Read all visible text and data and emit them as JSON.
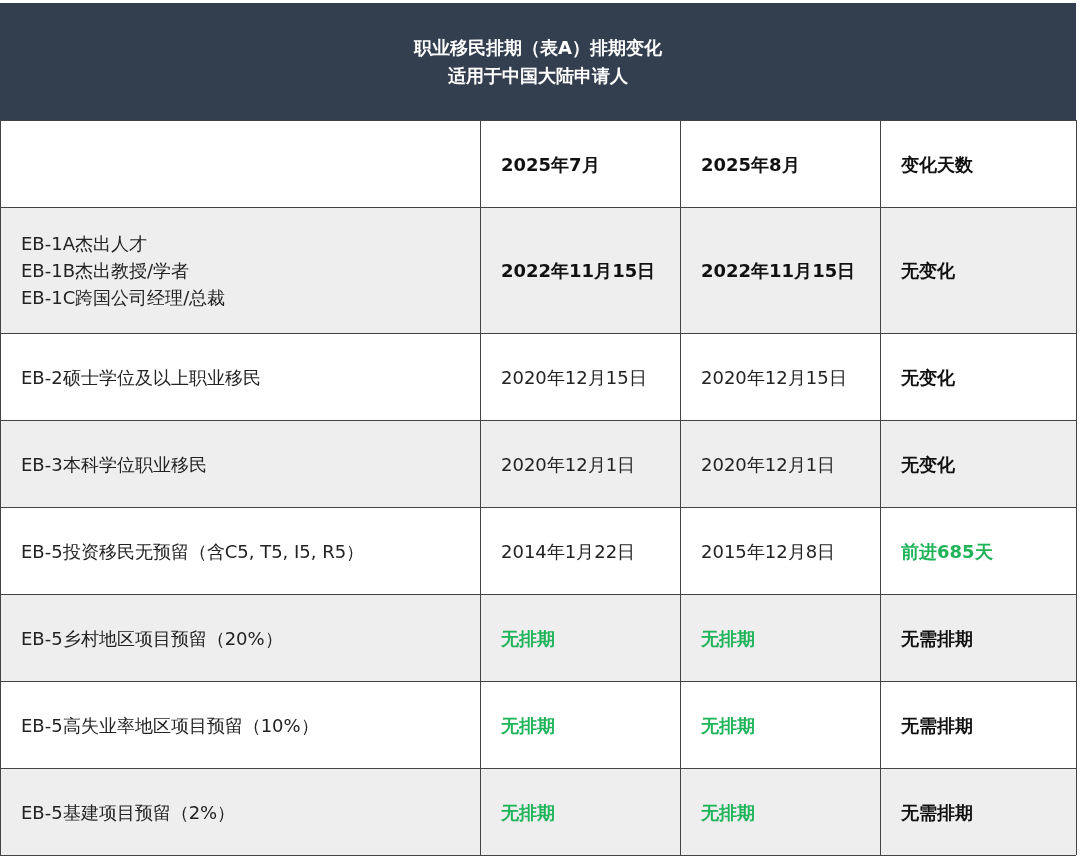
{
  "title": {
    "lines": [
      "职业移民排期（表A）排期变化",
      "适用于中国大陆申请人"
    ]
  },
  "table": {
    "columns": [
      "",
      "2025年7月",
      "2025年8月",
      "变化天数"
    ],
    "rows": [
      {
        "cells": [
          {
            "text": "EB-1A杰出人才\nEB-1B杰出教授/学者\nEB-1C跨国公司经理/总裁",
            "bold": false,
            "color": "#222222"
          },
          {
            "text": "2022年11月15日",
            "bold": true,
            "color": "#111111"
          },
          {
            "text": "2022年11月15日",
            "bold": true,
            "color": "#111111"
          },
          {
            "text": "无变化",
            "bold": true,
            "color": "#111111"
          }
        ]
      },
      {
        "cells": [
          {
            "text": "EB-2硕士学位及以上职业移民",
            "bold": false,
            "color": "#222222"
          },
          {
            "text": "2020年12月15日",
            "bold": false,
            "color": "#222222"
          },
          {
            "text": "2020年12月15日",
            "bold": false,
            "color": "#222222"
          },
          {
            "text": "无变化",
            "bold": true,
            "color": "#111111"
          }
        ]
      },
      {
        "cells": [
          {
            "text": "EB-3本科学位职业移民",
            "bold": false,
            "color": "#222222"
          },
          {
            "text": "2020年12月1日",
            "bold": false,
            "color": "#222222"
          },
          {
            "text": "2020年12月1日",
            "bold": false,
            "color": "#222222"
          },
          {
            "text": "无变化",
            "bold": true,
            "color": "#111111"
          }
        ]
      },
      {
        "cells": [
          {
            "text": "EB-5投资移民无预留（含C5, T5, I5, R5）",
            "bold": false,
            "color": "#222222"
          },
          {
            "text": "2014年1月22日",
            "bold": false,
            "color": "#222222"
          },
          {
            "text": "2015年12月8日",
            "bold": false,
            "color": "#222222"
          },
          {
            "text": "前进685天",
            "bold": true,
            "color": "#1fb45a"
          }
        ]
      },
      {
        "cells": [
          {
            "text": "EB-5乡村地区项目预留（20%）",
            "bold": false,
            "color": "#222222"
          },
          {
            "text": "无排期",
            "bold": true,
            "color": "#1fb45a"
          },
          {
            "text": "无排期",
            "bold": true,
            "color": "#1fb45a"
          },
          {
            "text": "无需排期",
            "bold": true,
            "color": "#111111"
          }
        ]
      },
      {
        "cells": [
          {
            "text": "EB-5高失业率地区项目预留（10%）",
            "bold": false,
            "color": "#222222"
          },
          {
            "text": "无排期",
            "bold": true,
            "color": "#1fb45a"
          },
          {
            "text": "无排期",
            "bold": true,
            "color": "#1fb45a"
          },
          {
            "text": "无需排期",
            "bold": true,
            "color": "#111111"
          }
        ]
      },
      {
        "cells": [
          {
            "text": "EB-5基建项目预留（2%）",
            "bold": false,
            "color": "#222222"
          },
          {
            "text": "无排期",
            "bold": true,
            "color": "#1fb45a"
          },
          {
            "text": "无排期",
            "bold": true,
            "color": "#1fb45a"
          },
          {
            "text": "无需排期",
            "bold": true,
            "color": "#111111"
          }
        ]
      }
    ]
  }
}
